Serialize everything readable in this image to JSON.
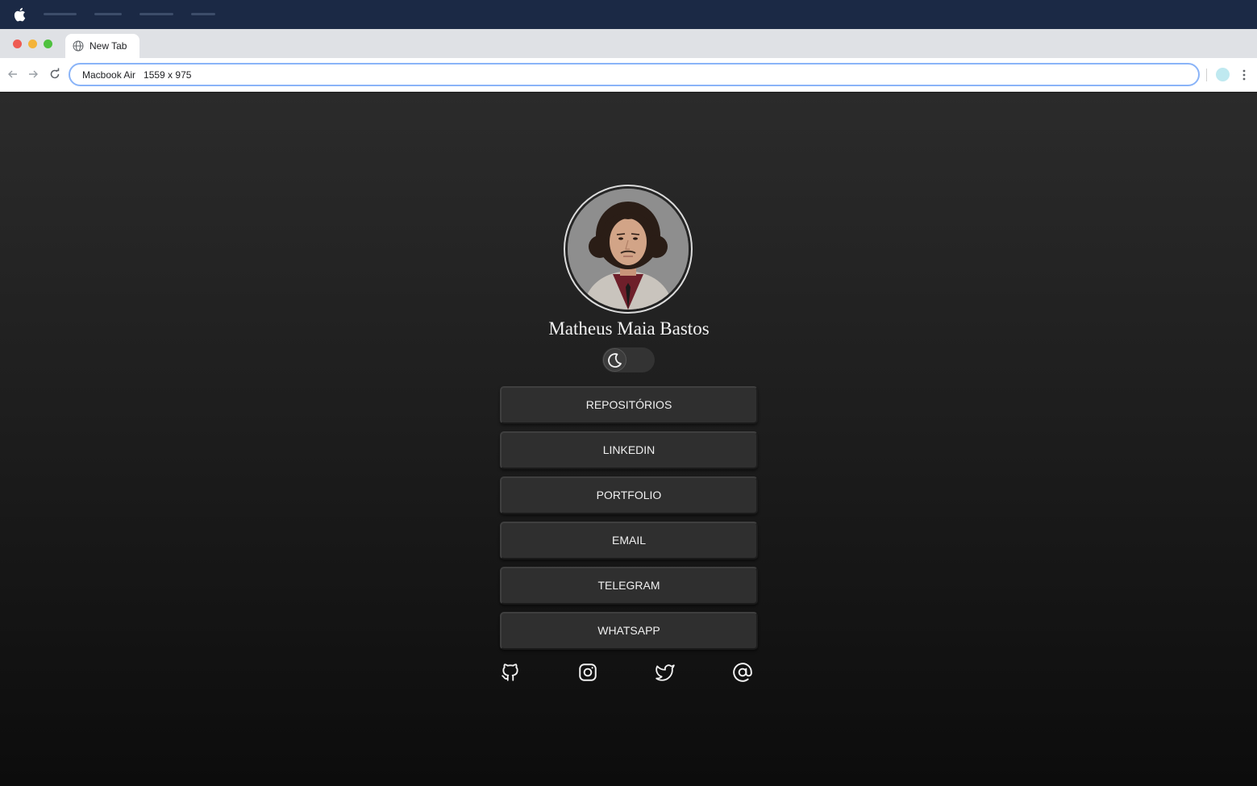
{
  "browser": {
    "tab_title": "New Tab",
    "address_bar": "Macbook Air   1559 x 975"
  },
  "profile": {
    "name": "Matheus Maia Bastos",
    "theme_toggle": "dark-mode-moon-icon"
  },
  "links": [
    {
      "label": "REPOSITÓRIOS"
    },
    {
      "label": "LINKEDIN"
    },
    {
      "label": "PORTFOLIO"
    },
    {
      "label": "EMAIL"
    },
    {
      "label": "TELEGRAM"
    },
    {
      "label": "WHATSAPP"
    }
  ],
  "socials": [
    "github-icon",
    "instagram-icon",
    "twitter-icon",
    "at-sign-icon"
  ],
  "colors": {
    "menubar": "#1b2945",
    "button_bg": "#2f2f2f",
    "page_top": "#2b2b2b",
    "page_bottom": "#0c0c0c"
  }
}
